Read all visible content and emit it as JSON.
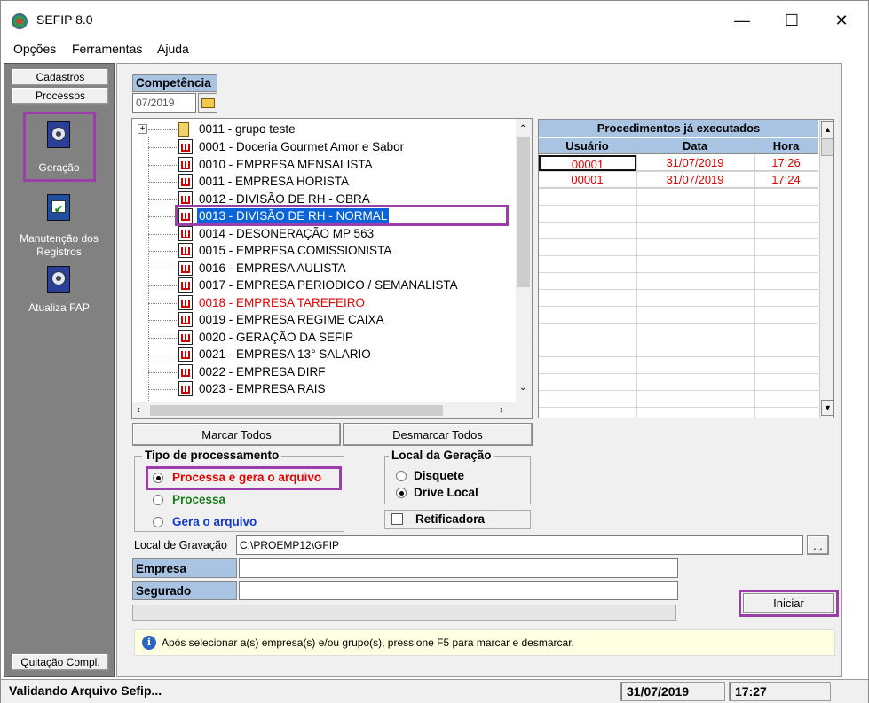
{
  "window": {
    "title": "SEFIP 8.0",
    "min": "—",
    "max": "☐",
    "close": "✕"
  },
  "menu": [
    "Opções",
    "Ferramentas",
    "Ajuda"
  ],
  "left": {
    "cadastros": "Cadastros",
    "processos": "Processos",
    "tools": [
      {
        "label": "Geração"
      },
      {
        "label": "Manutenção dos Registros"
      },
      {
        "label": "Atualiza FAP"
      }
    ],
    "quitacao": "Quitação Compl."
  },
  "competencia": {
    "label": "Competência",
    "value": "07/2019"
  },
  "tree": {
    "group": {
      "expander": "+",
      "label": "0011 - grupo teste"
    },
    "items": [
      {
        "label": "0001 - Doceria Gourmet Amor e Sabor",
        "color": "#000000"
      },
      {
        "label": "0010 - EMPRESA MENSALISTA",
        "color": "#000000"
      },
      {
        "label": "0011 - EMPRESA HORISTA",
        "color": "#000000"
      },
      {
        "label": "0012 - DIVISÃO DE RH - OBRA",
        "color": "#000000"
      },
      {
        "label": "0013 - DIVISÃO DE RH - NORMAL",
        "color": "#ffffff",
        "selected": true
      },
      {
        "label": "0014 - DESONERAÇÃO MP 563",
        "color": "#000000"
      },
      {
        "label": "0015 - EMPRESA COMISSIONISTA",
        "color": "#000000"
      },
      {
        "label": "0016 - EMPRESA AULISTA",
        "color": "#000000"
      },
      {
        "label": "0017 - EMPRESA PERIODICO / SEMANALISTA",
        "color": "#000000"
      },
      {
        "label": "0018 - EMPRESA TAREFEIRO",
        "color": "#e00000"
      },
      {
        "label": "0019 - EMPRESA REGIME CAIXA",
        "color": "#000000"
      },
      {
        "label": "0020 - GERAÇÃO DA SEFIP",
        "color": "#000000"
      },
      {
        "label": "0021 - EMPRESA 13° SALARIO",
        "color": "#000000"
      },
      {
        "label": "0022 - EMPRESA DIRF",
        "color": "#000000"
      },
      {
        "label": "0023 - EMPRESA RAIS",
        "color": "#000000"
      }
    ]
  },
  "procedimentos": {
    "title": "Procedimentos já executados",
    "headers": [
      "Usuário",
      "Data",
      "Hora"
    ],
    "rows": [
      [
        "00001",
        "31/07/2019",
        "17:26"
      ],
      [
        "00001",
        "31/07/2019",
        "17:24"
      ]
    ]
  },
  "buttons": {
    "marcar": "Marcar Todos",
    "desmarcar": "Desmarcar Todos",
    "browse": "...",
    "iniciar": "Iniciar"
  },
  "tipo": {
    "title": "Tipo de processamento",
    "options": [
      {
        "label": "Processa e gera o arquivo",
        "color": "#e00000",
        "checked": true
      },
      {
        "label": "Processa",
        "color": "#1a7a1a",
        "checked": false
      },
      {
        "label": "Gera o arquivo",
        "color": "#1438c8",
        "checked": false
      }
    ]
  },
  "local": {
    "title": "Local da Geração",
    "options": [
      {
        "label": "Disquete",
        "checked": false
      },
      {
        "label": "Drive Local",
        "checked": true
      }
    ]
  },
  "retificadora": {
    "label": "Retificadora",
    "checked": false
  },
  "gravacao": {
    "label": "Local de Gravação",
    "value": "C:\\PROEMP12\\GFIP"
  },
  "empresa": {
    "label": "Empresa",
    "value": ""
  },
  "segurado": {
    "label": "Segurado",
    "value": ""
  },
  "info": "Após selecionar a(s) empresa(s) e/ou grupo(s), pressione F5 para marcar e desmarcar.",
  "status": {
    "message": "Validando Arquivo Sefip...",
    "date": "31/07/2019",
    "time": "17:27"
  }
}
